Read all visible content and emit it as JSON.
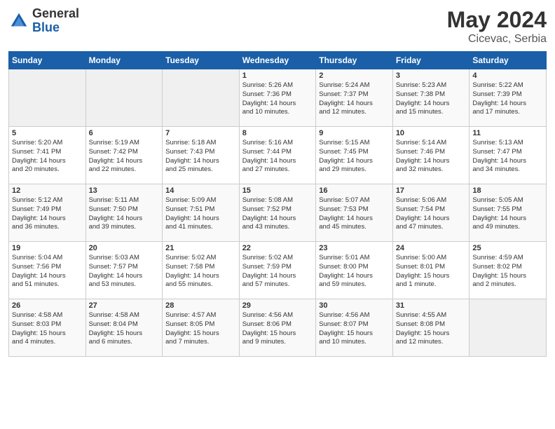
{
  "header": {
    "logo_general": "General",
    "logo_blue": "Blue",
    "month_year": "May 2024",
    "location": "Cicevac, Serbia"
  },
  "calendar": {
    "days_of_week": [
      "Sunday",
      "Monday",
      "Tuesday",
      "Wednesday",
      "Thursday",
      "Friday",
      "Saturday"
    ],
    "weeks": [
      [
        {
          "day": "",
          "info": ""
        },
        {
          "day": "",
          "info": ""
        },
        {
          "day": "",
          "info": ""
        },
        {
          "day": "1",
          "info": "Sunrise: 5:26 AM\nSunset: 7:36 PM\nDaylight: 14 hours\nand 10 minutes."
        },
        {
          "day": "2",
          "info": "Sunrise: 5:24 AM\nSunset: 7:37 PM\nDaylight: 14 hours\nand 12 minutes."
        },
        {
          "day": "3",
          "info": "Sunrise: 5:23 AM\nSunset: 7:38 PM\nDaylight: 14 hours\nand 15 minutes."
        },
        {
          "day": "4",
          "info": "Sunrise: 5:22 AM\nSunset: 7:39 PM\nDaylight: 14 hours\nand 17 minutes."
        }
      ],
      [
        {
          "day": "5",
          "info": "Sunrise: 5:20 AM\nSunset: 7:41 PM\nDaylight: 14 hours\nand 20 minutes."
        },
        {
          "day": "6",
          "info": "Sunrise: 5:19 AM\nSunset: 7:42 PM\nDaylight: 14 hours\nand 22 minutes."
        },
        {
          "day": "7",
          "info": "Sunrise: 5:18 AM\nSunset: 7:43 PM\nDaylight: 14 hours\nand 25 minutes."
        },
        {
          "day": "8",
          "info": "Sunrise: 5:16 AM\nSunset: 7:44 PM\nDaylight: 14 hours\nand 27 minutes."
        },
        {
          "day": "9",
          "info": "Sunrise: 5:15 AM\nSunset: 7:45 PM\nDaylight: 14 hours\nand 29 minutes."
        },
        {
          "day": "10",
          "info": "Sunrise: 5:14 AM\nSunset: 7:46 PM\nDaylight: 14 hours\nand 32 minutes."
        },
        {
          "day": "11",
          "info": "Sunrise: 5:13 AM\nSunset: 7:47 PM\nDaylight: 14 hours\nand 34 minutes."
        }
      ],
      [
        {
          "day": "12",
          "info": "Sunrise: 5:12 AM\nSunset: 7:49 PM\nDaylight: 14 hours\nand 36 minutes."
        },
        {
          "day": "13",
          "info": "Sunrise: 5:11 AM\nSunset: 7:50 PM\nDaylight: 14 hours\nand 39 minutes."
        },
        {
          "day": "14",
          "info": "Sunrise: 5:09 AM\nSunset: 7:51 PM\nDaylight: 14 hours\nand 41 minutes."
        },
        {
          "day": "15",
          "info": "Sunrise: 5:08 AM\nSunset: 7:52 PM\nDaylight: 14 hours\nand 43 minutes."
        },
        {
          "day": "16",
          "info": "Sunrise: 5:07 AM\nSunset: 7:53 PM\nDaylight: 14 hours\nand 45 minutes."
        },
        {
          "day": "17",
          "info": "Sunrise: 5:06 AM\nSunset: 7:54 PM\nDaylight: 14 hours\nand 47 minutes."
        },
        {
          "day": "18",
          "info": "Sunrise: 5:05 AM\nSunset: 7:55 PM\nDaylight: 14 hours\nand 49 minutes."
        }
      ],
      [
        {
          "day": "19",
          "info": "Sunrise: 5:04 AM\nSunset: 7:56 PM\nDaylight: 14 hours\nand 51 minutes."
        },
        {
          "day": "20",
          "info": "Sunrise: 5:03 AM\nSunset: 7:57 PM\nDaylight: 14 hours\nand 53 minutes."
        },
        {
          "day": "21",
          "info": "Sunrise: 5:02 AM\nSunset: 7:58 PM\nDaylight: 14 hours\nand 55 minutes."
        },
        {
          "day": "22",
          "info": "Sunrise: 5:02 AM\nSunset: 7:59 PM\nDaylight: 14 hours\nand 57 minutes."
        },
        {
          "day": "23",
          "info": "Sunrise: 5:01 AM\nSunset: 8:00 PM\nDaylight: 14 hours\nand 59 minutes."
        },
        {
          "day": "24",
          "info": "Sunrise: 5:00 AM\nSunset: 8:01 PM\nDaylight: 15 hours\nand 1 minute."
        },
        {
          "day": "25",
          "info": "Sunrise: 4:59 AM\nSunset: 8:02 PM\nDaylight: 15 hours\nand 2 minutes."
        }
      ],
      [
        {
          "day": "26",
          "info": "Sunrise: 4:58 AM\nSunset: 8:03 PM\nDaylight: 15 hours\nand 4 minutes."
        },
        {
          "day": "27",
          "info": "Sunrise: 4:58 AM\nSunset: 8:04 PM\nDaylight: 15 hours\nand 6 minutes."
        },
        {
          "day": "28",
          "info": "Sunrise: 4:57 AM\nSunset: 8:05 PM\nDaylight: 15 hours\nand 7 minutes."
        },
        {
          "day": "29",
          "info": "Sunrise: 4:56 AM\nSunset: 8:06 PM\nDaylight: 15 hours\nand 9 minutes."
        },
        {
          "day": "30",
          "info": "Sunrise: 4:56 AM\nSunset: 8:07 PM\nDaylight: 15 hours\nand 10 minutes."
        },
        {
          "day": "31",
          "info": "Sunrise: 4:55 AM\nSunset: 8:08 PM\nDaylight: 15 hours\nand 12 minutes."
        },
        {
          "day": "",
          "info": ""
        }
      ]
    ]
  }
}
